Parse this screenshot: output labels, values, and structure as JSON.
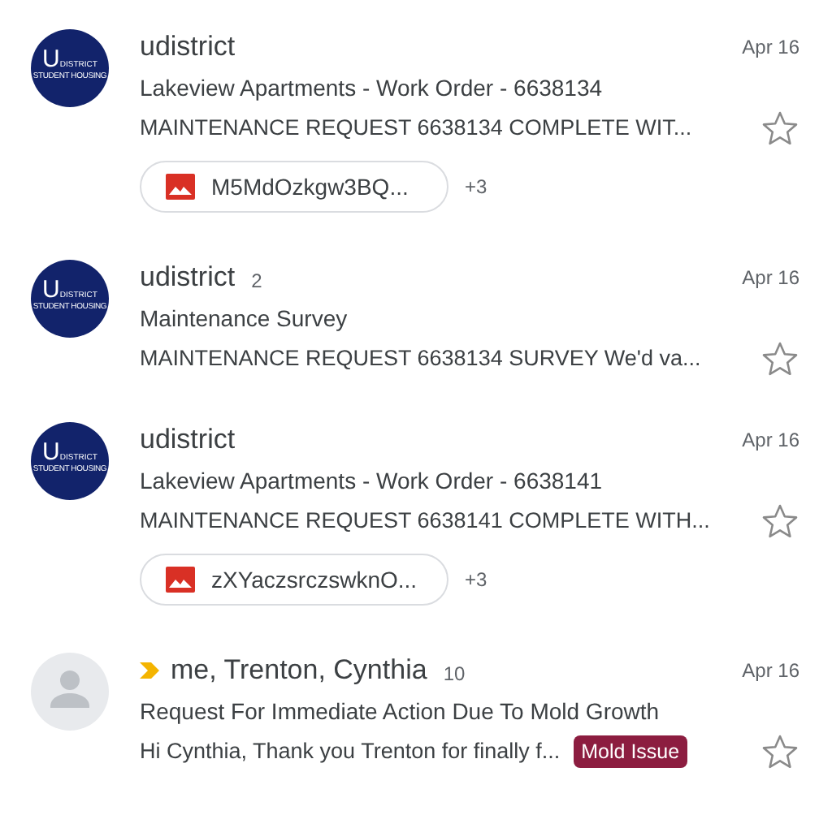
{
  "threads": [
    {
      "avatar": {
        "kind": "logo",
        "letter": "U",
        "name": "DISTRICT",
        "tagline": "STUDENT HOUSING"
      },
      "important": false,
      "sender": "udistrict",
      "date": "Apr 16",
      "subject": "Lakeview Apartments - Work Order - 6638134",
      "snippet": "MAINTENANCE REQUEST 6638134 COMPLETE WIT...",
      "starred": false,
      "attachment": {
        "name": "M5MdOzkgw3BQ...",
        "more": "+3"
      }
    },
    {
      "avatar": {
        "kind": "logo",
        "letter": "U",
        "name": "DISTRICT",
        "tagline": "STUDENT HOUSING"
      },
      "important": false,
      "sender": "udistrict",
      "count": "2",
      "date": "Apr 16",
      "subject": "Maintenance Survey",
      "snippet": "MAINTENANCE REQUEST 6638134 SURVEY We'd va...",
      "starred": false
    },
    {
      "avatar": {
        "kind": "logo",
        "letter": "U",
        "name": "DISTRICT",
        "tagline": "STUDENT HOUSING"
      },
      "important": false,
      "sender": "udistrict",
      "date": "Apr 16",
      "subject": "Lakeview Apartments - Work Order - 6638141",
      "snippet": "MAINTENANCE REQUEST 6638141 COMPLETE WITH...",
      "starred": false,
      "attachment": {
        "name": "zXYaczsrczswknO...",
        "more": "+3"
      }
    },
    {
      "avatar": {
        "kind": "person"
      },
      "important": true,
      "sender": "me, Trenton, Cynthia",
      "count": "10",
      "date": "Apr 16",
      "subject": "Request For Immediate Action Due To Mold Growth",
      "snippet": "Hi Cynthia, Thank you Trenton for finally f...",
      "starred": false,
      "label": {
        "text": "Mold Issue",
        "color": "#8c1d40"
      }
    }
  ]
}
